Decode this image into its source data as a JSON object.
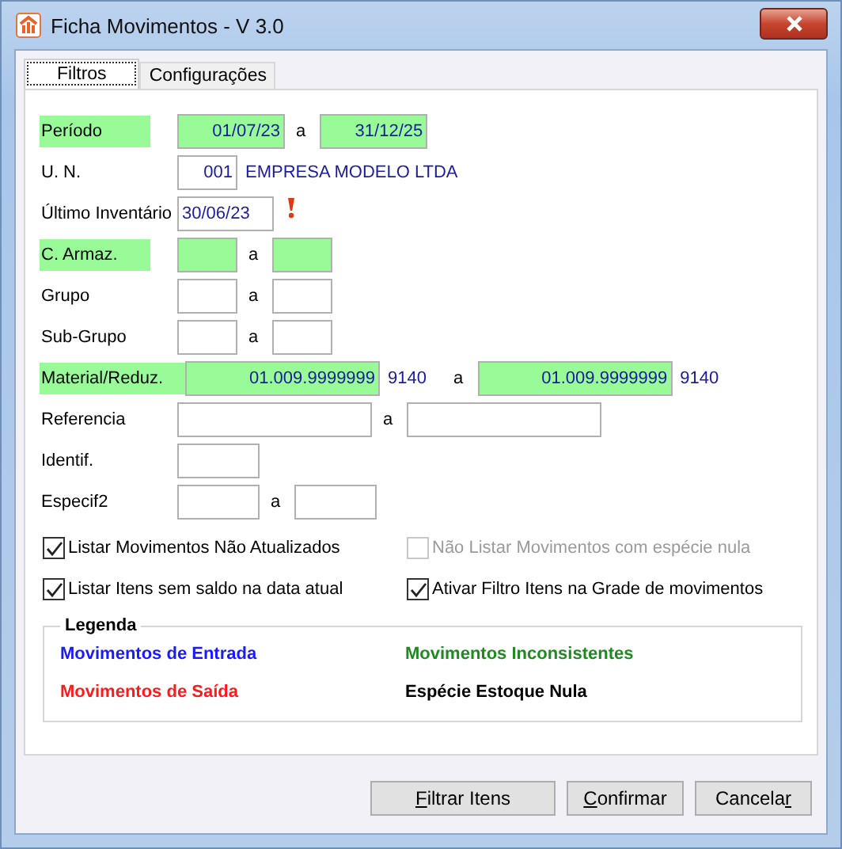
{
  "window": {
    "title": "Ficha Movimentos - V 3.0"
  },
  "tabs": [
    {
      "label": "Filtros",
      "selected": true
    },
    {
      "label": "Configurações",
      "selected": false
    }
  ],
  "rows": [
    {
      "label": "Período",
      "highlighted": true,
      "fields": [
        {
          "kind": "date",
          "value": "01/07/23",
          "highlighted": true
        },
        {
          "kind": "date",
          "value": "31/12/25",
          "highlighted": true
        }
      ],
      "separator": "a"
    },
    {
      "label": "U. N.",
      "highlighted": false,
      "fields": [
        {
          "kind": "code",
          "value": "001",
          "highlighted": false,
          "note": "EMPRESA MODELO LTDA"
        }
      ]
    },
    {
      "label": "Último Inventário",
      "highlighted": false,
      "fields": [
        {
          "kind": "inventory",
          "value": "30/06/23",
          "highlighted": false,
          "alert": true
        }
      ]
    },
    {
      "label": "C. Armaz.",
      "highlighted": true,
      "fields": [
        {
          "kind": "code",
          "highlighted": true
        },
        {
          "kind": "code",
          "highlighted": true
        }
      ],
      "separator": "a"
    },
    {
      "label": "Grupo",
      "highlighted": false,
      "fields": [
        {
          "kind": "code",
          "highlighted": false
        },
        {
          "kind": "code",
          "highlighted": false
        }
      ],
      "separator": "a"
    },
    {
      "label": "Sub-Grupo",
      "highlighted": false,
      "fields": [
        {
          "kind": "code",
          "highlighted": false
        },
        {
          "kind": "code",
          "highlighted": false
        }
      ],
      "separator": "a"
    },
    {
      "label": "Material/Reduz.",
      "highlighted": true,
      "fields": [
        {
          "kind": "wide",
          "value": "01.009.9999999",
          "highlighted": true,
          "note": "9140"
        },
        {
          "kind": "wide",
          "value": "01.009.9999999",
          "highlighted": true,
          "note": "9140"
        }
      ],
      "separator": "a"
    },
    {
      "label": "Referencia",
      "highlighted": false,
      "fields": [
        {
          "kind": "wide",
          "highlighted": false
        },
        {
          "kind": "wide",
          "highlighted": false
        }
      ],
      "separator": "a"
    },
    {
      "label": "Identif.",
      "highlighted": false,
      "fields": [
        {
          "kind": "mid",
          "highlighted": false
        }
      ]
    },
    {
      "label": "Especif2",
      "highlighted": false,
      "fields": [
        {
          "kind": "mid",
          "highlighted": false
        },
        {
          "kind": "mid",
          "highlighted": false
        }
      ],
      "separator": "a"
    }
  ],
  "checkboxes": [
    {
      "label": "Listar Movimentos Não Atualizados",
      "checked": true,
      "disabled": false
    },
    {
      "label": "Não Listar Movimentos com espécie nula",
      "checked": false,
      "disabled": true
    },
    {
      "label": "Listar Itens sem saldo na data atual",
      "checked": true,
      "disabled": false
    },
    {
      "label": "Ativar Filtro Itens na Grade de movimentos",
      "checked": true,
      "disabled": false
    }
  ],
  "legend": {
    "title": "Legenda",
    "items": [
      {
        "label": "Movimentos de Entrada",
        "color": "#1a1aff"
      },
      {
        "label": "Movimentos Inconsistentes",
        "color": "#1f8a1f"
      },
      {
        "label": "Movimentos de Saída",
        "color": "#ff1a1a"
      },
      {
        "label": "Espécie Estoque Nula",
        "color": "#000000"
      }
    ]
  },
  "buttons": [
    {
      "key": "F",
      "after": "iltrar Itens"
    },
    {
      "key": "C",
      "after": "onfirmar"
    },
    {
      "before": "Cancela",
      "key": "r"
    }
  ]
}
